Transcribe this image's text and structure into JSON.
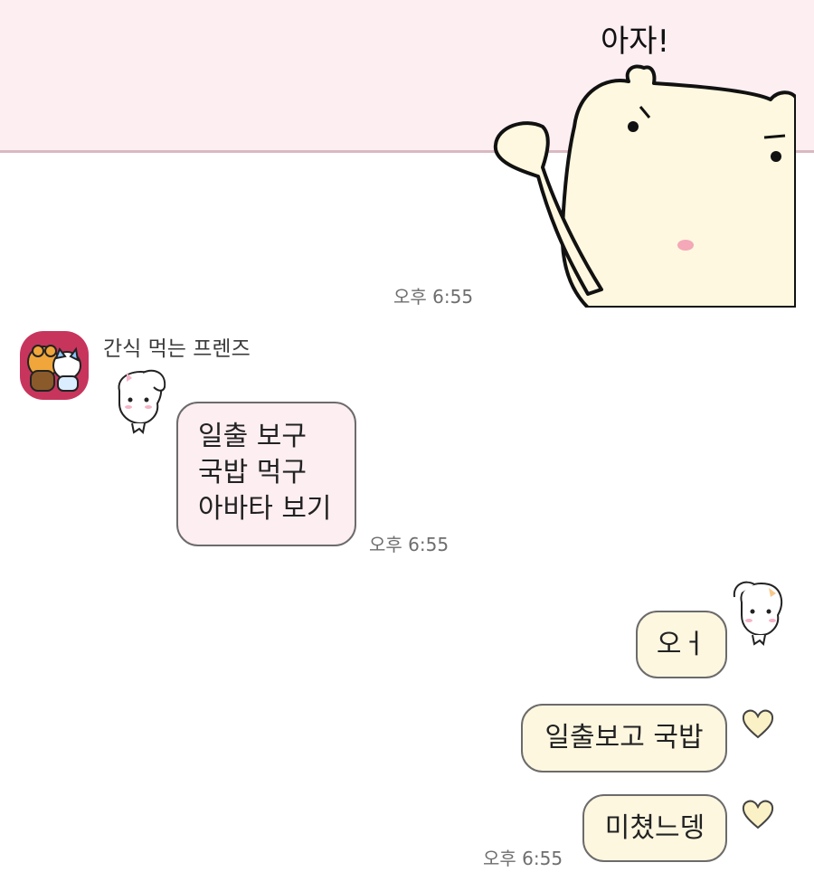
{
  "header_sticker": {
    "caption": "아자!"
  },
  "messages": {
    "sticker_time": "오후 6:55",
    "incoming": {
      "sender": "간식 먹는 프렌즈",
      "lines": [
        "일출 보구",
        "국밥 먹구",
        "아바타 보기"
      ],
      "time": "오후 6:55"
    },
    "outgoing": [
      {
        "text": "오ㅓ"
      },
      {
        "text": "일출보고 국밥"
      },
      {
        "text": "미쳤느뎅"
      }
    ],
    "outgoing_time": "오후 6:55"
  },
  "colors": {
    "incoming_bubble": "#fdeef1",
    "outgoing_bubble": "#fdf7e0",
    "top_band": "#fdeef2",
    "avatar_bg": "#c7355c"
  },
  "icons": [
    "bear-sticker-icon",
    "puppy-sticker-icon",
    "heart-reaction-icon"
  ]
}
